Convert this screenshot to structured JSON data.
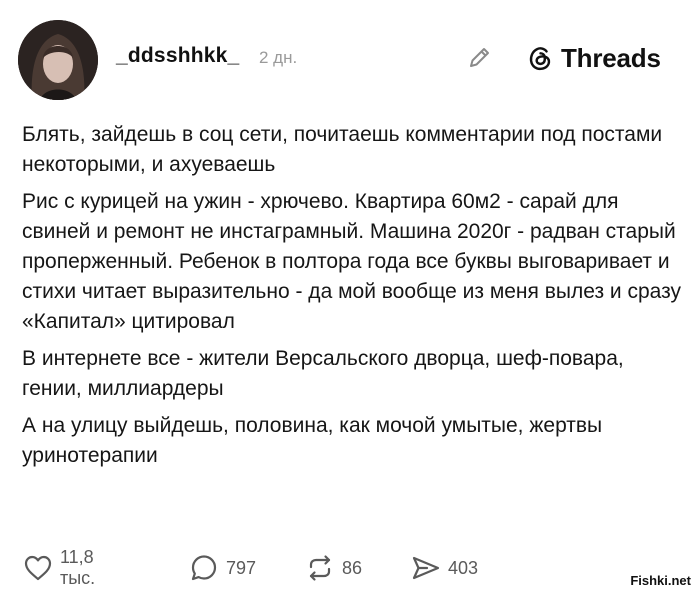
{
  "post": {
    "author": {
      "username": "_ddsshhkk_",
      "time": "2 дн."
    },
    "brand": {
      "name": "Threads"
    },
    "paragraphs": [
      "Блять, зайдешь в соц сети, почитаешь комментарии под постами некоторыми, и ахуеваешь",
      "Рис с курицей на ужин - хрючево. Квартира 60м2 - сарай для свиней и ремонт не инстаграмный. Машина 2020г - радван старый проперженный. Ребенок в полтора года все буквы выговаривает и стихи читает выразительно - да мой вообще из меня вылез и сразу «Капитал» цитировал",
      "В интернете все - жители Версальского дворца, шеф-повара, гении, миллиардеры",
      "А на улицу выйдешь, половина, как мочой умытые, жертвы уринотерапии"
    ],
    "stats": {
      "likes": "11,8 тыс.",
      "replies": "797",
      "reposts": "86",
      "shares": "403"
    },
    "icons": {
      "like": "heart-icon",
      "reply": "comment-icon",
      "repost": "repost-icon",
      "share": "send-icon",
      "edit": "pencil-icon",
      "brand": "threads-logo-icon"
    }
  },
  "watermark": "Fishki.net",
  "colors": {
    "text": "#161616",
    "muted": "#9a9a9a",
    "icon": "#5a5a5a",
    "background": "#ffffff"
  }
}
